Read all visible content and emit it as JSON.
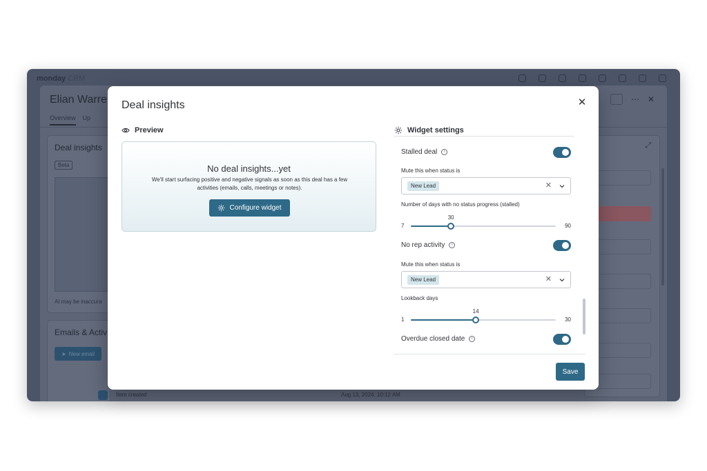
{
  "background": {
    "app_name": "monday",
    "app_suffix": "CRM",
    "item_title": "Elian Warre",
    "tabs": [
      "Overview",
      "Up"
    ],
    "left_card_title": "Deal insights",
    "beta_label": "Beta",
    "ai_note": "AI may be inaccura",
    "emails_title": "Emails & Activ",
    "new_email_label": "New email",
    "timeline_label": "Item created",
    "timeline_date": "Aug 13, 2024, 10:12 AM"
  },
  "modal": {
    "title": "Deal insights",
    "close_icon": "close-icon",
    "preview": {
      "heading": "Preview",
      "empty_title": "No deal insights...yet",
      "empty_desc": "We'll start surfacing positive and negative signals as soon as this deal has a few activities (emails, calls, meetings or notes).",
      "button_label": "Configure widget"
    },
    "settings": {
      "heading": "Widget settings",
      "stalled": {
        "label": "Stalled deal",
        "enabled": true,
        "mute_label": "Mute this when status is",
        "mute_value": "New Lead",
        "days_label": "Number of days with no status progress (stalled)",
        "slider": {
          "min": 7,
          "max": 90,
          "value": 30
        }
      },
      "no_rep": {
        "label": "No rep activity",
        "enabled": true,
        "mute_label": "Mute this when status is",
        "mute_value": "New Lead",
        "days_label": "Lookback days",
        "slider": {
          "min": 1,
          "max": 30,
          "value": 14
        }
      },
      "overdue": {
        "label": "Overdue closed date",
        "enabled": true
      }
    },
    "save_label": "Save"
  },
  "colors": {
    "accent": "#2e6987",
    "chip_bg": "#d3e6ec",
    "overlay": "#4c5568"
  }
}
